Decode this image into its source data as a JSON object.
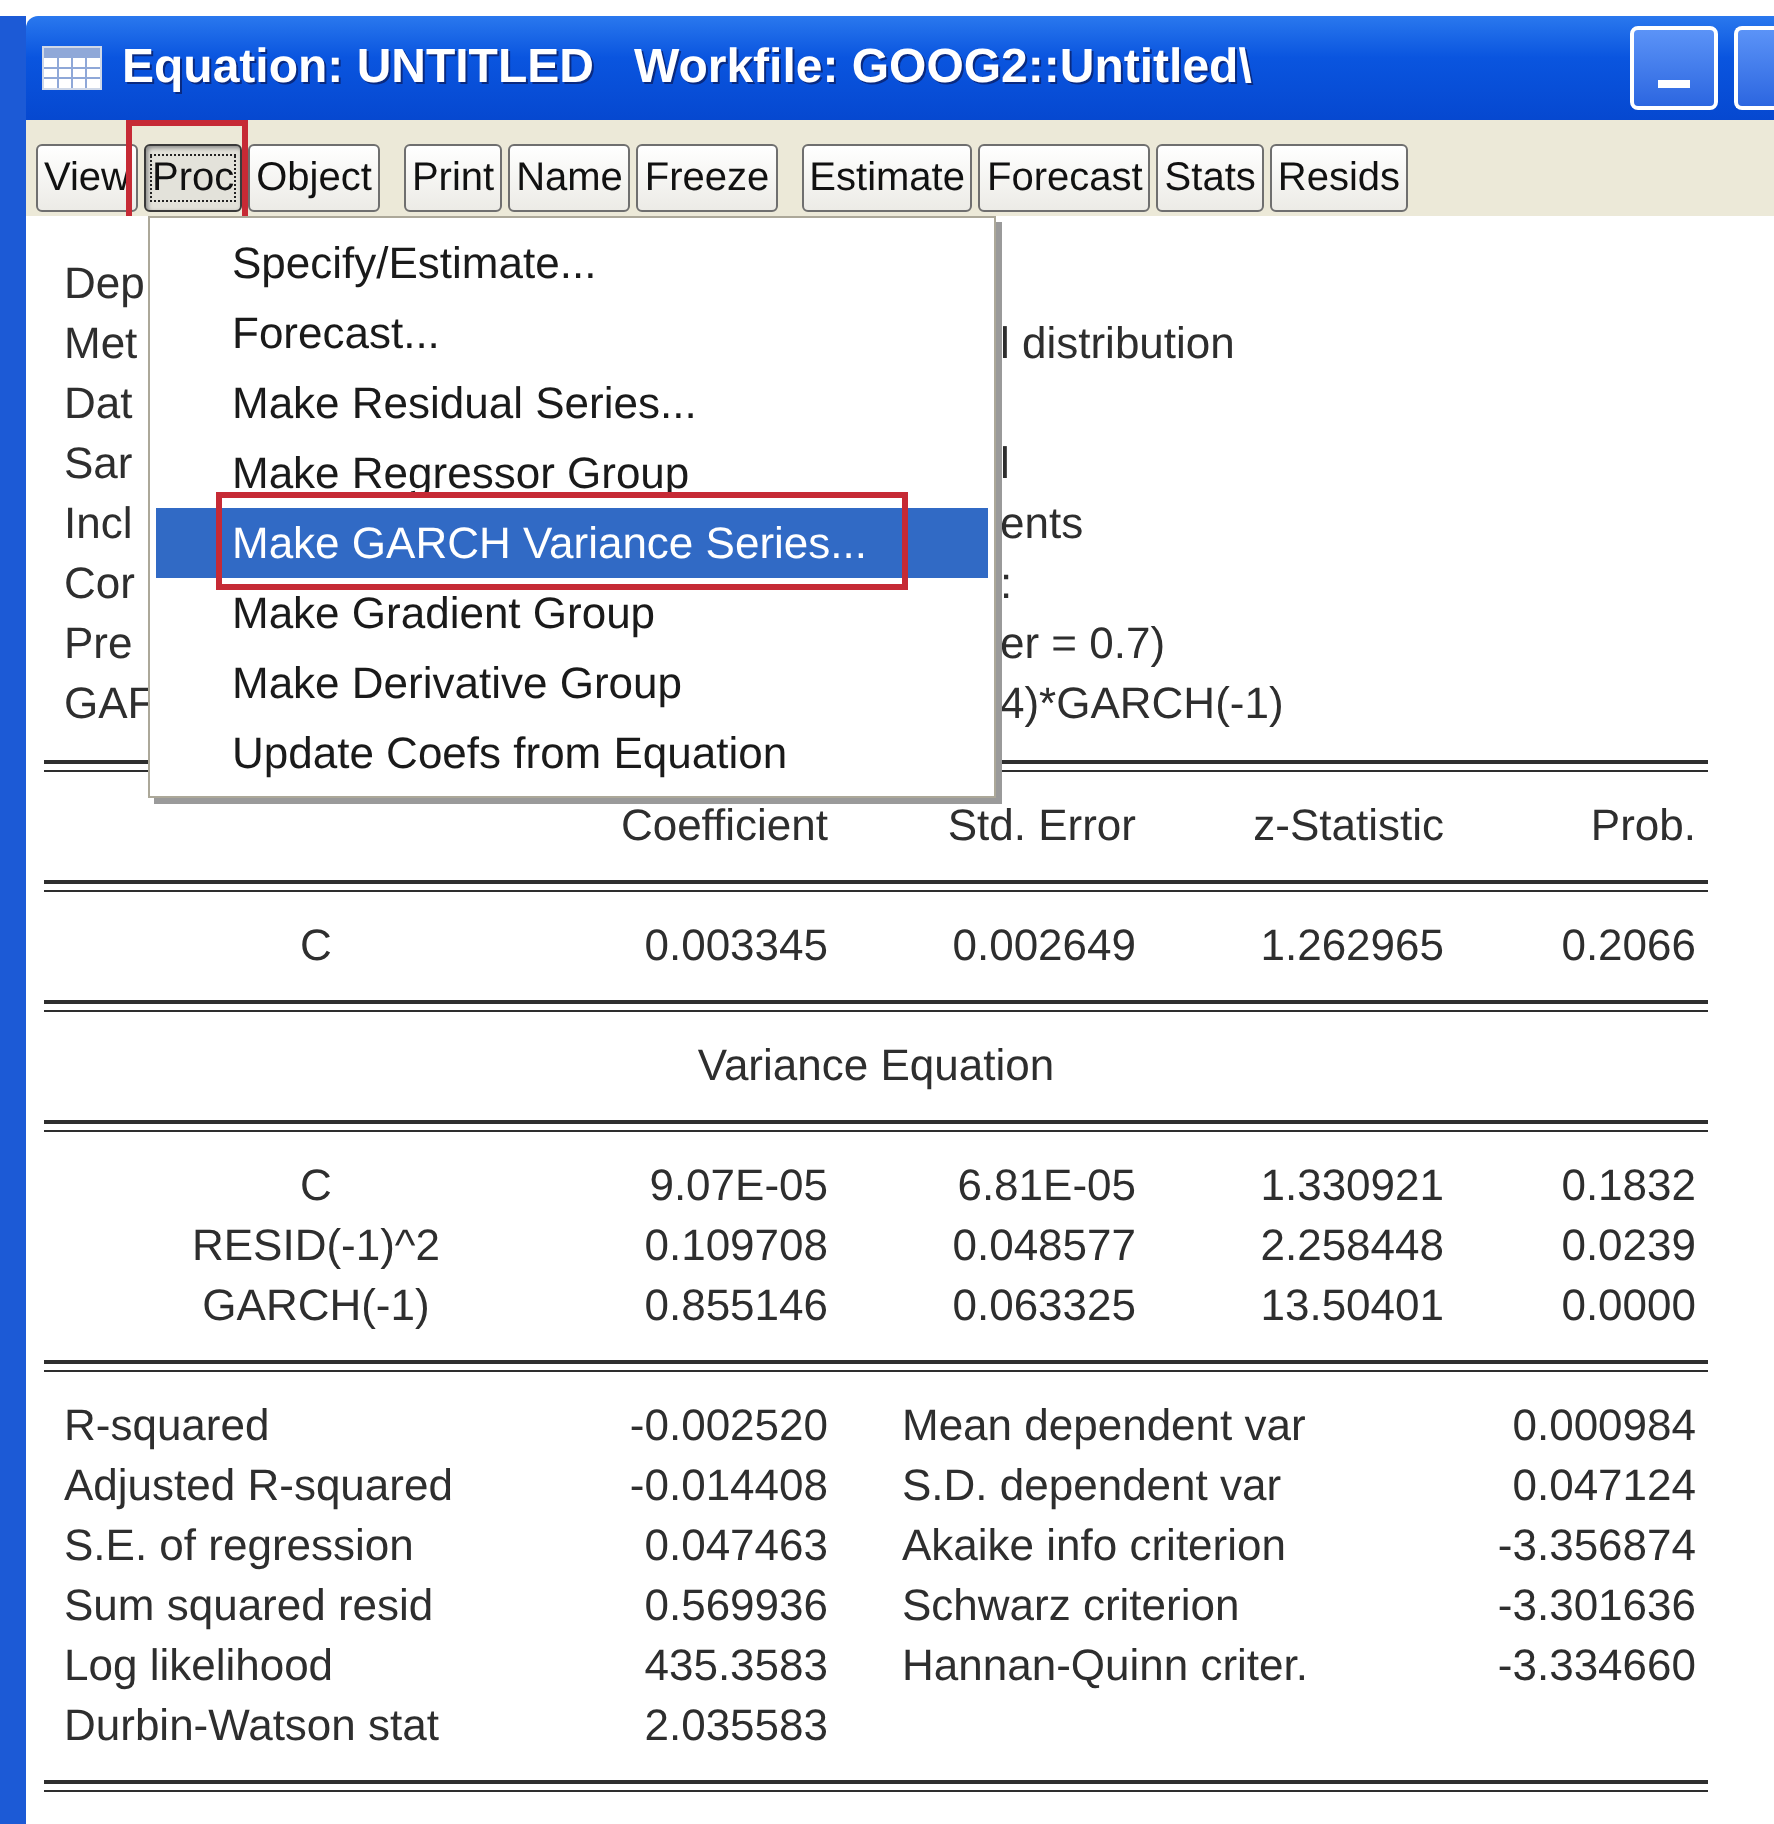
{
  "window": {
    "title": "Equation: UNTITLED   Workfile: GOOG2::Untitled\\"
  },
  "toolbar": {
    "groups": [
      [
        {
          "label": "View",
          "selected": false,
          "outlined": false
        },
        {
          "label": "Proc",
          "selected": true,
          "outlined": true
        },
        {
          "label": "Object",
          "selected": false,
          "outlined": false
        }
      ],
      [
        {
          "label": "Print",
          "selected": false,
          "outlined": false
        },
        {
          "label": "Name",
          "selected": false,
          "outlined": false
        },
        {
          "label": "Freeze",
          "selected": false,
          "outlined": false
        }
      ],
      [
        {
          "label": "Estimate",
          "selected": false,
          "outlined": false
        },
        {
          "label": "Forecast",
          "selected": false,
          "outlined": false
        },
        {
          "label": "Stats",
          "selected": false,
          "outlined": false
        },
        {
          "label": "Resids",
          "selected": false,
          "outlined": false
        }
      ]
    ]
  },
  "menu": {
    "items": [
      {
        "label": "Specify/Estimate...",
        "selected": false,
        "outlined": false
      },
      {
        "label": "Forecast...",
        "selected": false,
        "outlined": false
      },
      {
        "label": "Make Residual Series...",
        "selected": false,
        "outlined": false
      },
      {
        "label": "Make Regressor Group",
        "selected": false,
        "outlined": false
      },
      {
        "label": "Make GARCH Variance Series...",
        "selected": true,
        "outlined": true
      },
      {
        "label": "Make Gradient Group",
        "selected": false,
        "outlined": false
      },
      {
        "label": "Make Derivative Group",
        "selected": false,
        "outlined": false
      },
      {
        "label": "Update Coefs from Equation",
        "selected": false,
        "outlined": false
      }
    ]
  },
  "header_lines": [
    {
      "left": "Dep"
    },
    {
      "left": "Met",
      "right": "l distribution"
    },
    {
      "left": "Dat"
    },
    {
      "left": "Sar",
      "right": "l"
    },
    {
      "left": "Incl",
      "right": "ents"
    },
    {
      "left": "Cor",
      "right": ":"
    },
    {
      "left": "Pre",
      "right": "er = 0.7)"
    },
    {
      "left": "GAF",
      "right": "4)*GARCH(-1)"
    }
  ],
  "table": {
    "columns": [
      "Coefficient",
      "Std. Error",
      "z-Statistic",
      "Prob."
    ],
    "mean_rows": [
      [
        "C",
        "0.003345",
        "0.002649",
        "1.262965",
        "0.2066"
      ]
    ],
    "variance_title": "Variance Equation",
    "variance_rows": [
      [
        "C",
        "9.07E-05",
        "6.81E-05",
        "1.330921",
        "0.1832"
      ],
      [
        "RESID(-1)^2",
        "0.109708",
        "0.048577",
        "2.258448",
        "0.0239"
      ],
      [
        "GARCH(-1)",
        "0.855146",
        "0.063325",
        "13.50401",
        "0.0000"
      ]
    ],
    "stats": [
      [
        "R-squared",
        "-0.002520",
        "Mean dependent var",
        "0.000984"
      ],
      [
        "Adjusted R-squared",
        "-0.014408",
        "S.D. dependent var",
        "0.047124"
      ],
      [
        "S.E. of regression",
        "0.047463",
        "Akaike info criterion",
        "-3.356874"
      ],
      [
        "Sum squared resid",
        "0.569936",
        "Schwarz criterion",
        "-3.301636"
      ],
      [
        "Log likelihood",
        "435.3583",
        "Hannan-Quinn criter.",
        "-3.334660"
      ],
      [
        "Durbin-Watson stat",
        "2.035583"
      ]
    ]
  }
}
